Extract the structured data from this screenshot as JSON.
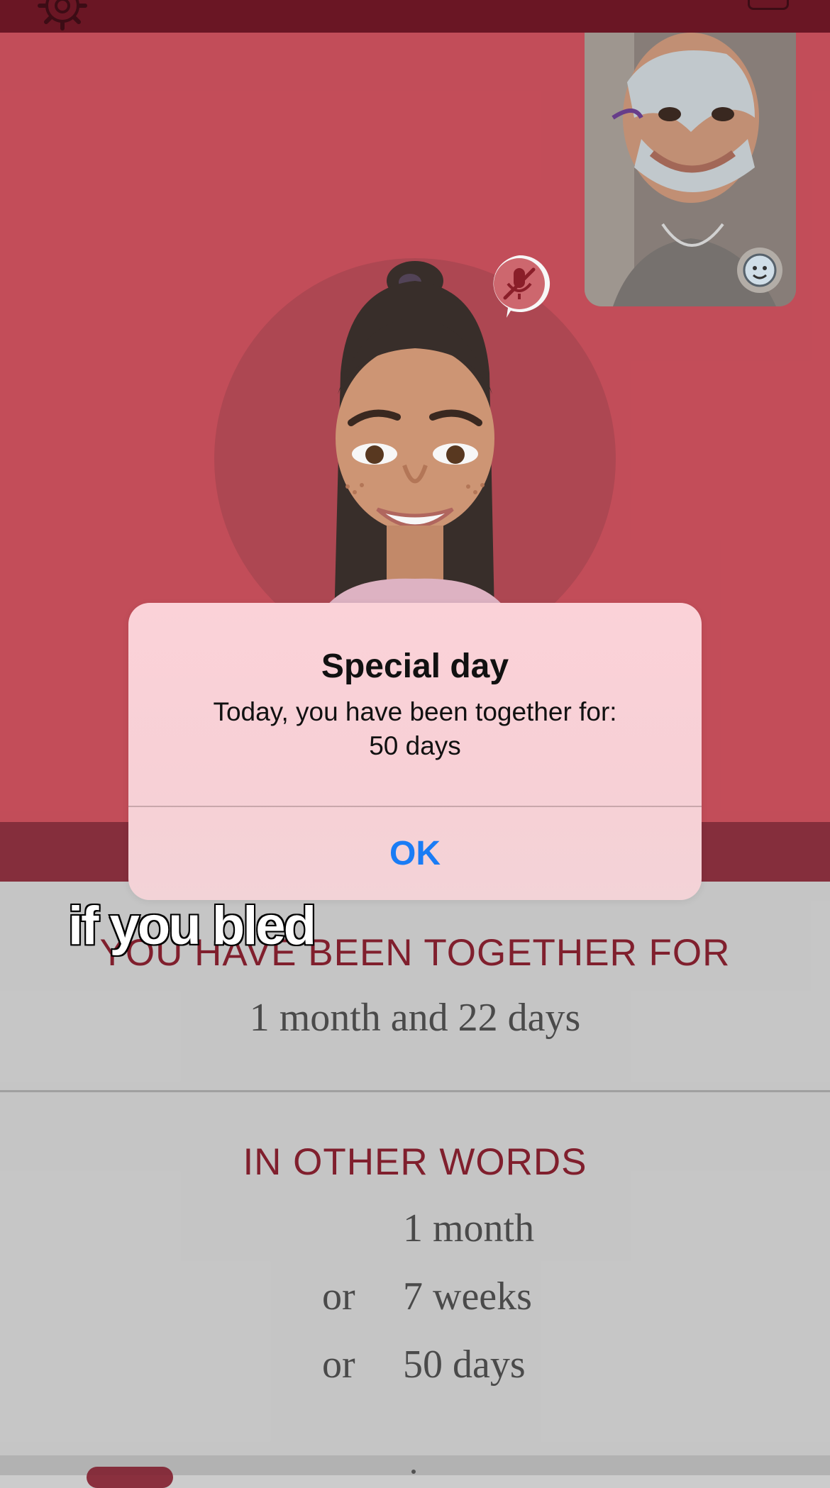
{
  "app": {
    "header": {
      "title_partial": "",
      "left_icon": "gear-icon",
      "right_icon": "chat-icon"
    },
    "call": {
      "avatar_status_icon": "mic-muted-icon",
      "pip_overlay_icon": "emoji-face-icon"
    },
    "summary": {
      "heading": "YOU HAVE BEEN TOGETHER FOR",
      "duration": "1 month and 22 days"
    },
    "in_other_words": {
      "heading": "IN OTHER WORDS",
      "rows": [
        {
          "prefix": "",
          "value": "1 month"
        },
        {
          "prefix": "or",
          "value": "7 weeks"
        },
        {
          "prefix": "or",
          "value": "50 days"
        }
      ]
    }
  },
  "alert": {
    "title": "Special day",
    "message": "Today, you have been together for:\n50 days",
    "ok_label": "OK"
  },
  "overlay_caption": "if you bled",
  "colors": {
    "accent_red": "#c9505c",
    "header_dark": "#6e1726",
    "heading_text": "#85202f",
    "alert_button": "#1a7cf5"
  }
}
